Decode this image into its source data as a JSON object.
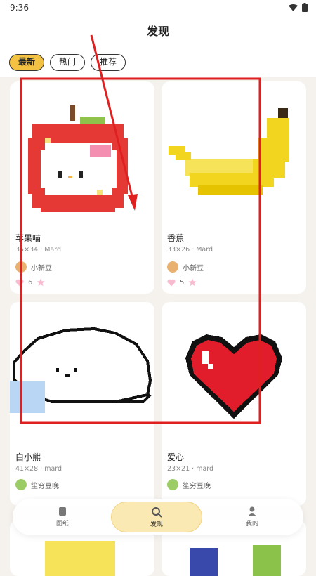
{
  "status_bar": {
    "time": "9:36"
  },
  "header": {
    "title": "发现"
  },
  "filters": [
    {
      "label": "最新",
      "active": true
    },
    {
      "label": "热门",
      "active": false
    },
    {
      "label": "推荐",
      "active": false
    }
  ],
  "cards": [
    {
      "title": "苹果喵",
      "meta": "35×34 · Mard",
      "author": "小新豆",
      "likes": "6"
    },
    {
      "title": "香蕉",
      "meta": "33×26 · Mard",
      "author": "小新豆",
      "likes": "5"
    },
    {
      "title": "白小熊",
      "meta": "41×28 · mard",
      "author": "笙穷豆晚",
      "likes": ""
    },
    {
      "title": "爱心",
      "meta": "23×21 · mard",
      "author": "笙穷豆晚",
      "likes": ""
    }
  ],
  "bottom_nav": [
    {
      "label": "图纸",
      "icon": "document-icon",
      "active": false
    },
    {
      "label": "发现",
      "icon": "search-icon",
      "active": true
    },
    {
      "label": "我的",
      "icon": "user-icon",
      "active": false
    }
  ],
  "colors": {
    "accent": "#f4c242",
    "annotation": "#e02020"
  }
}
